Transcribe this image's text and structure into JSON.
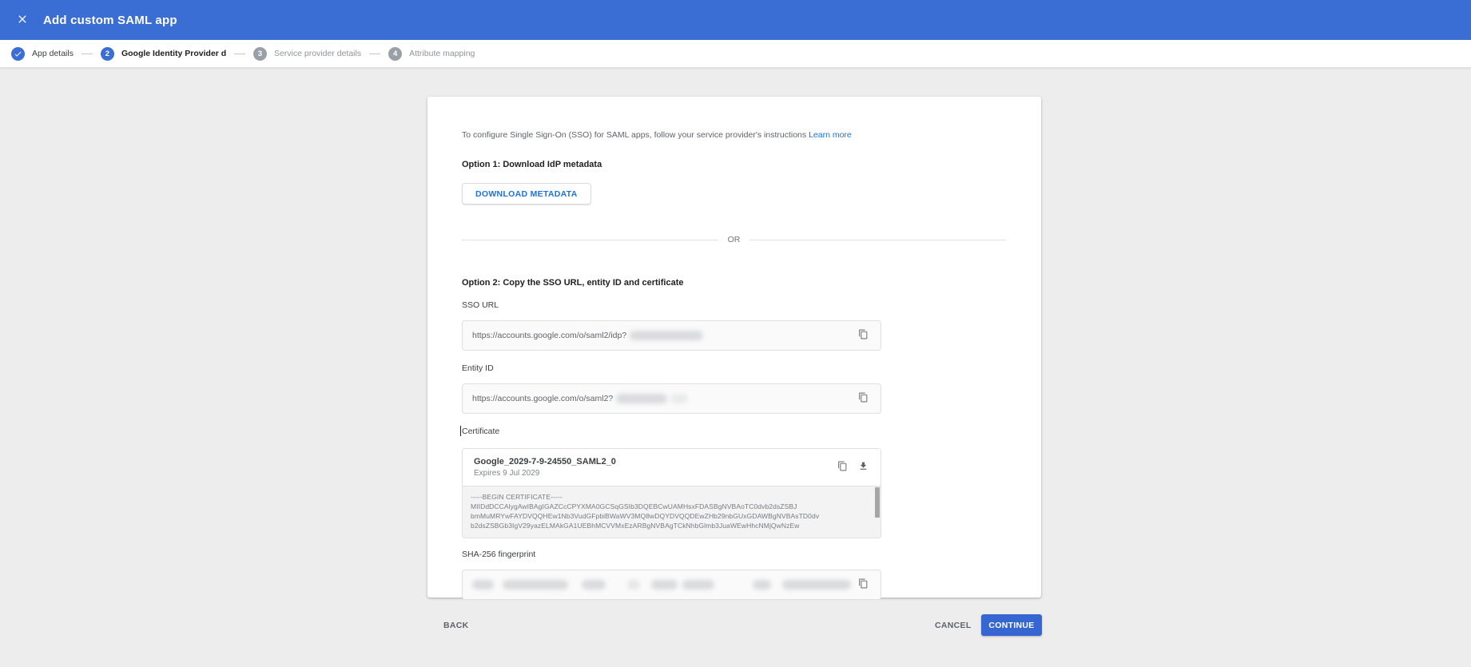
{
  "header": {
    "title": "Add custom SAML app"
  },
  "stepper": {
    "steps": [
      {
        "number": "1",
        "label": "App details",
        "state": "completed"
      },
      {
        "number": "2",
        "label": "Google Identity Provider details",
        "state": "active"
      },
      {
        "number": "3",
        "label": "Service provider details",
        "state": "upcoming"
      },
      {
        "number": "4",
        "label": "Attribute mapping",
        "state": "upcoming"
      }
    ]
  },
  "content": {
    "intro_text": "To configure Single Sign-On (SSO) for SAML apps, follow your service provider's instructions",
    "learn_more": "Learn more",
    "option1_heading": "Option 1: Download IdP metadata",
    "download_metadata_button": "DOWNLOAD METADATA",
    "divider_label": "OR",
    "option2_heading": "Option 2: Copy the SSO URL, entity ID and certificate",
    "sso_url": {
      "label": "SSO URL",
      "value": "https://accounts.google.com/o/saml2/idp?",
      "value_redacted": true
    },
    "entity_id": {
      "label": "Entity ID",
      "value": "https://accounts.google.com/o/saml2?",
      "value_redacted": true
    },
    "certificate": {
      "label": "Certificate",
      "name": "Google_2029-7-9-24550_SAML2_0",
      "expires": "Expires 9 Jul 2029",
      "pem_lines": [
        "-----BEGIN CERTIFICATE-----",
        "MIIDdDCCAlygAwIBAgIGAZCcCPYXMA0GCSqGSIb3DQEBCwUAMHsxFDASBgNVBAoTC0dvb2dsZSBJ",
        "bmMuMRYwFAYDVQQHEw1Nb3VudGFpbiBWaWV3MQ8wDQYDVQQDEwZHb29nbGUxGDAWBgNVBAsTD0dv",
        "b2dsZSBGb3IgV29yazELMAkGA1UEBhMCVVMxEzARBgNVBAgTCkNhbGlmb3JuaWEwHhcNMjQwNzEw"
      ]
    },
    "sha256": {
      "label": "SHA-256 fingerprint",
      "value_redacted": true
    }
  },
  "footer": {
    "back": "BACK",
    "cancel": "CANCEL",
    "continue": "CONTINUE"
  },
  "colors": {
    "header_blue": "#3b6ed4",
    "accent_blue": "#1a73e8",
    "continue_blue": "#3566d2",
    "step_inactive_gray": "#9aa0a6"
  }
}
